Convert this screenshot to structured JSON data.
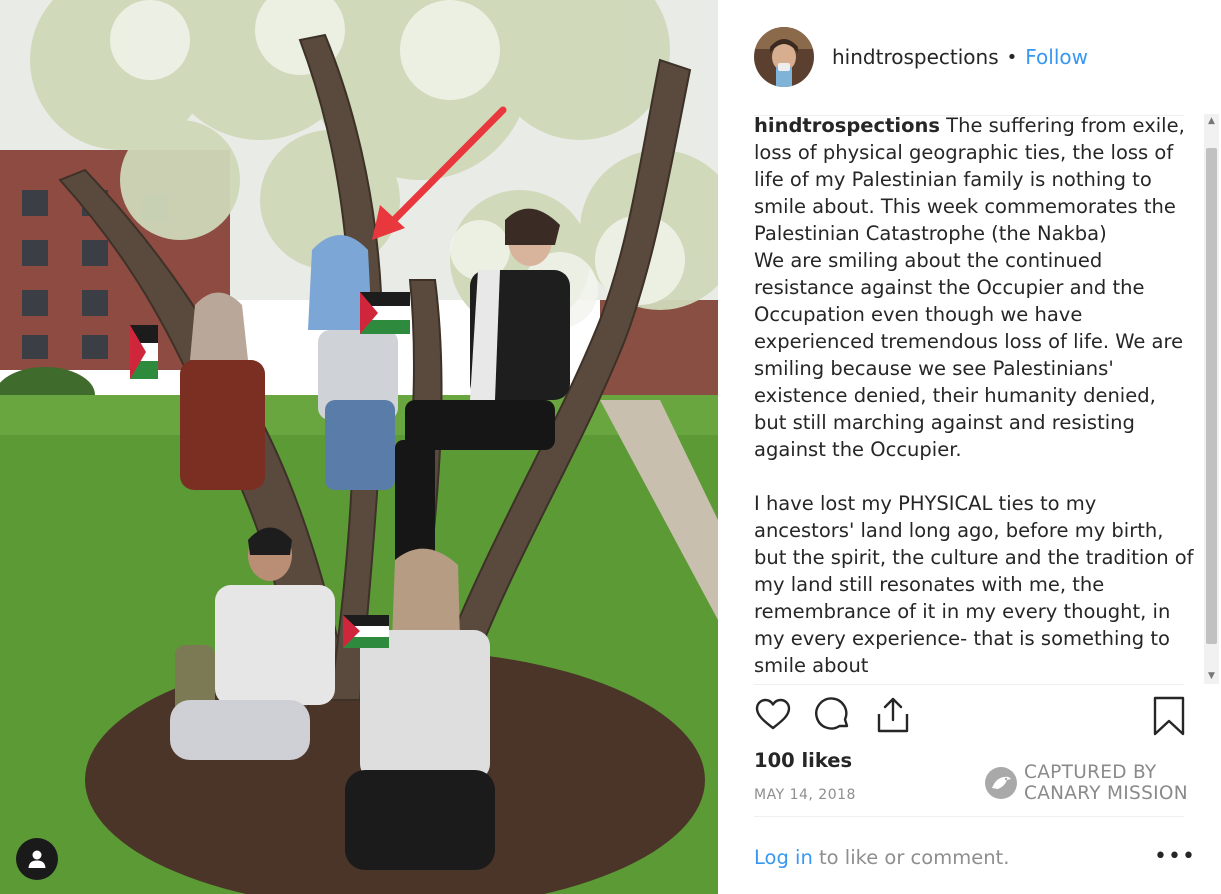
{
  "post": {
    "username": "hindtrospections",
    "separator": "•",
    "follow_label": "Follow",
    "caption_user": "hindtrospections",
    "caption_text": " The suffering from exile, loss of physical geographic ties, the loss of life of my Palestinian family is nothing to smile about. This week commemorates the Palestinian Catastrophe (the Nakba)\nWe are smiling about the continued resistance against the Occupier and the Occupation even though we have experienced tremendous loss of life. We are smiling because we see Palestinians' existence denied, their humanity denied, but still marching against and resisting against the Occupier.\n\nI have lost my PHYSICAL ties to my ancestors' land long ago, before my birth, but the spirit, the culture and the tradition of my land still resonates with me, the remembrance of it in my every thought, in my every experience- that is something to smile about",
    "likes": "100 likes",
    "date": "MAY 14, 2018",
    "login_link": "Log in",
    "login_suffix": " to like or comment.",
    "more_label": "•••"
  },
  "watermark": {
    "line1": "CAPTURED BY",
    "line2": "CANARY MISSION"
  },
  "icons": {
    "like": "heart-icon",
    "comment": "comment-icon",
    "share": "share-icon",
    "save": "bookmark-icon",
    "tag": "user-tag-icon"
  },
  "colors": {
    "link": "#3897f0",
    "text": "#262626",
    "muted": "#8e8e8e",
    "arrow": "#e8383d"
  }
}
